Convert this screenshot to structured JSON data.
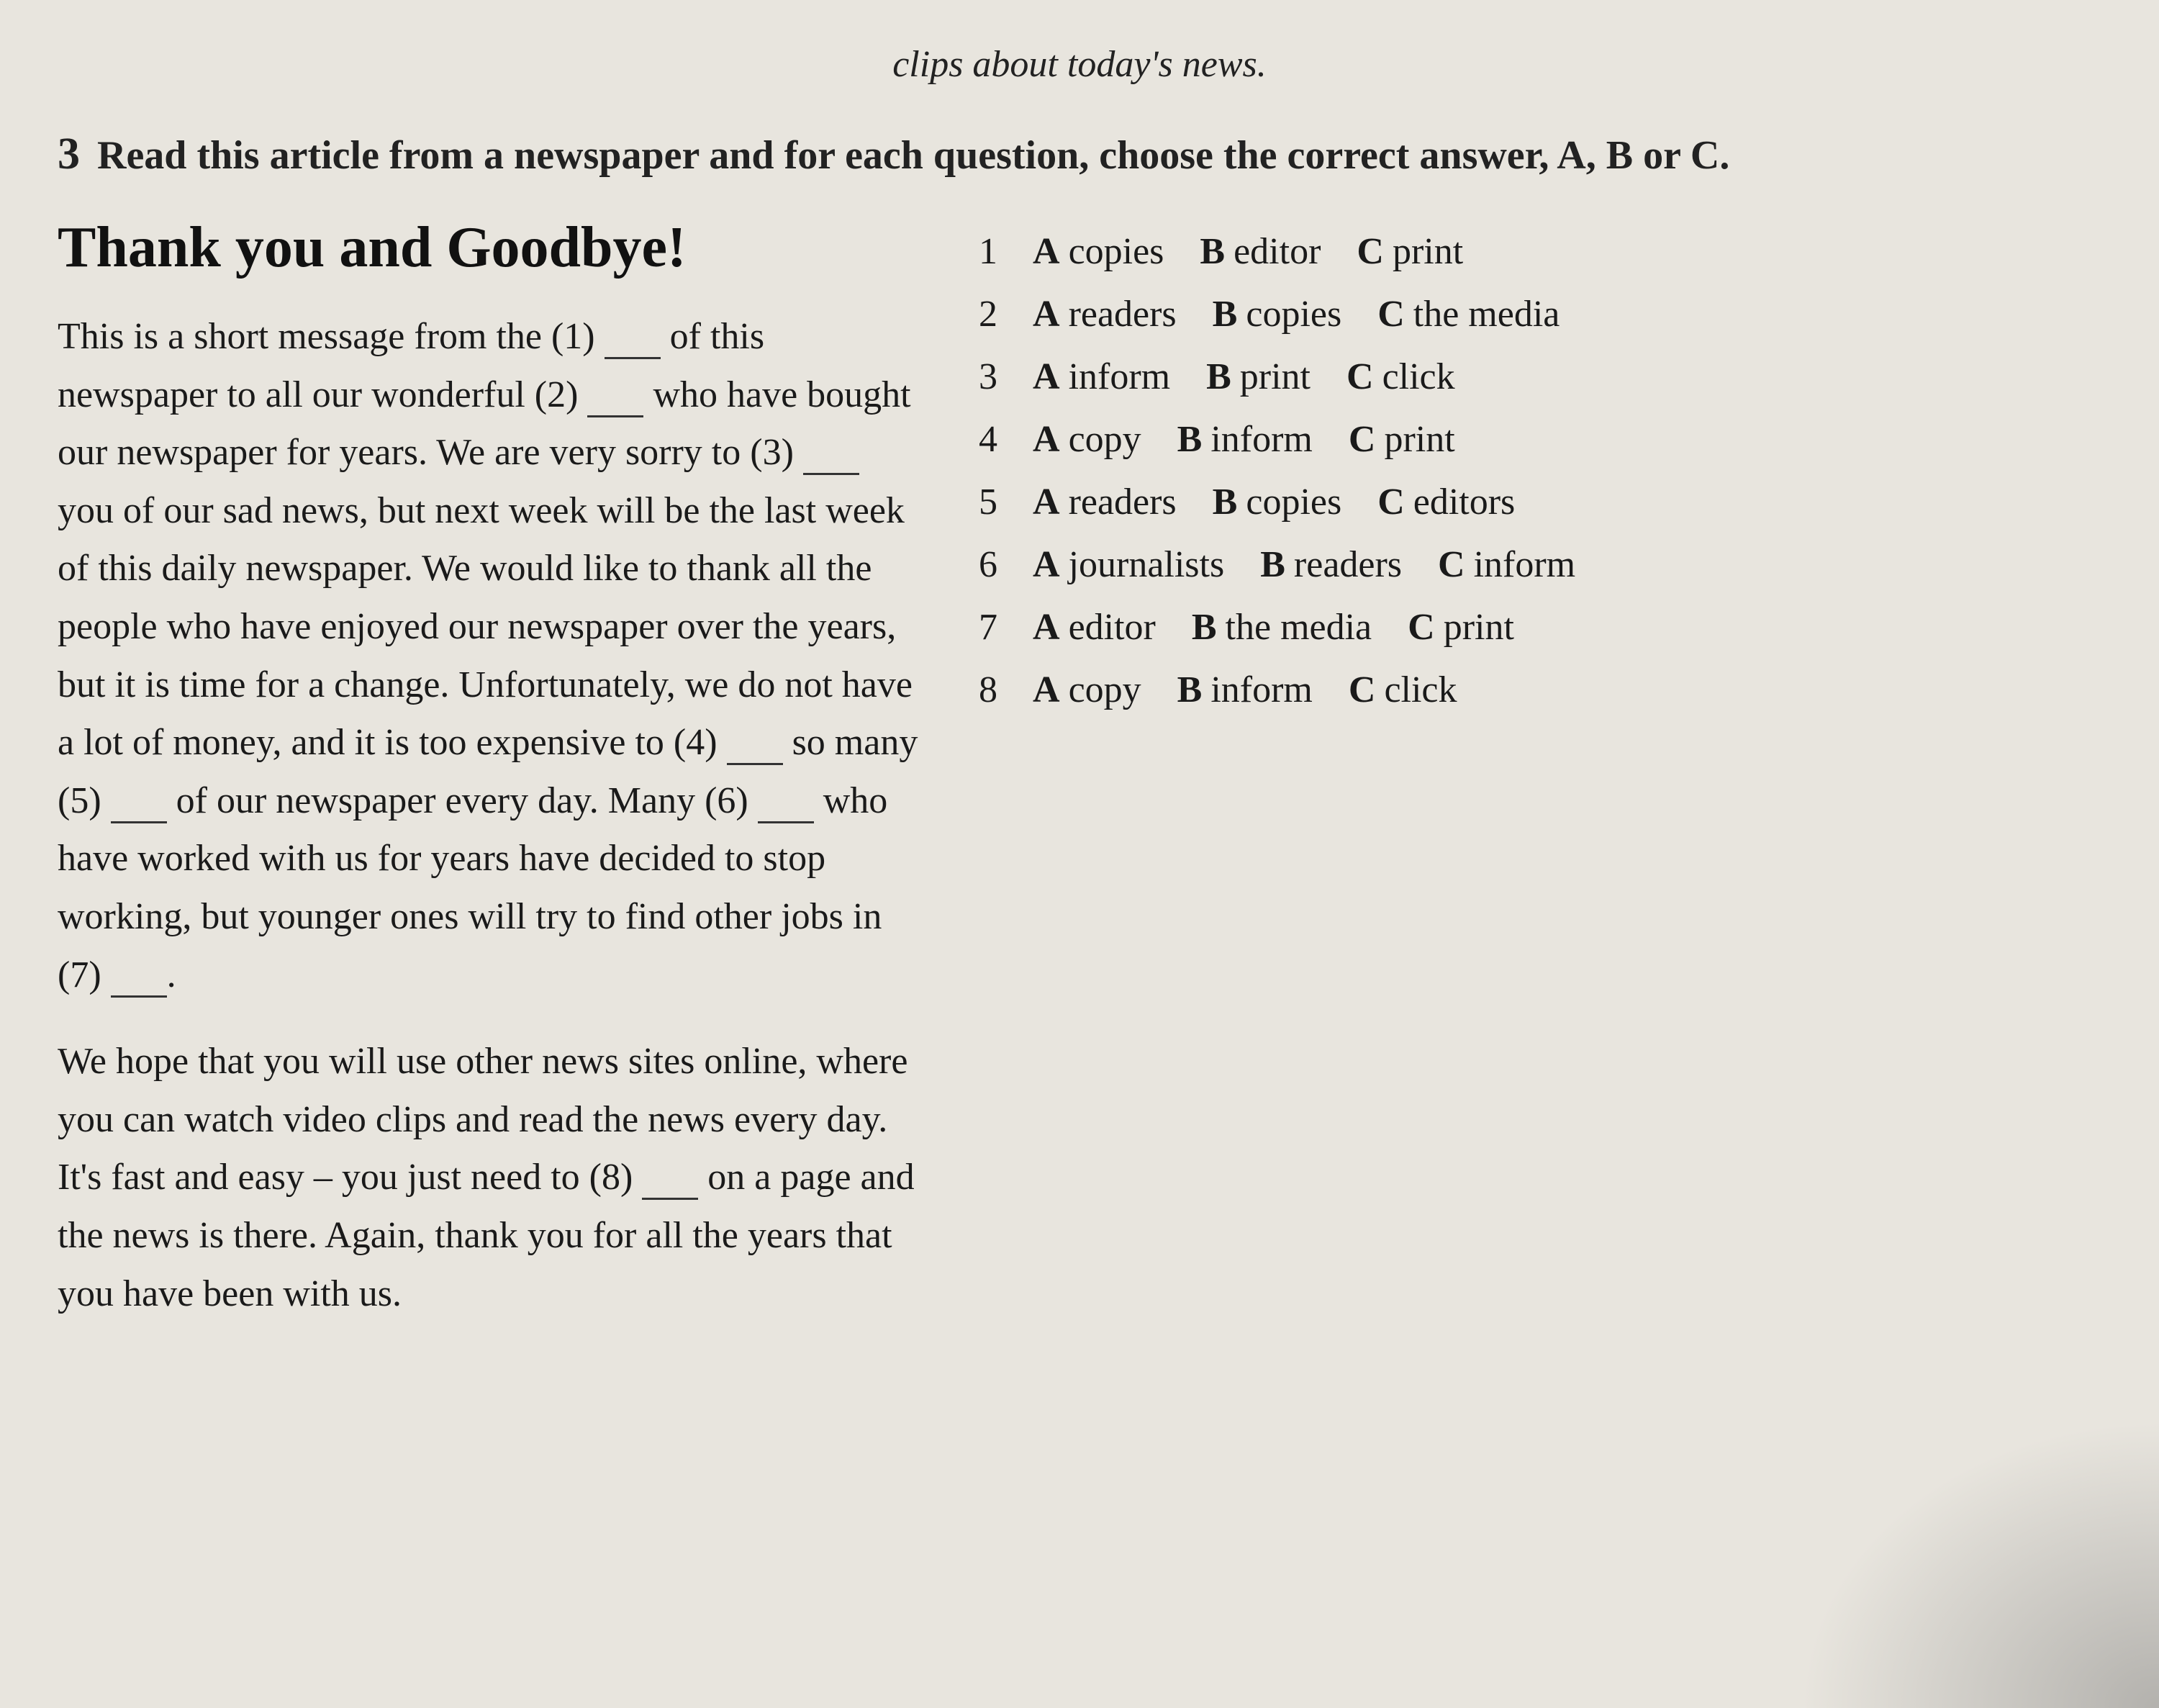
{
  "page": {
    "top_text": "clips about today's news.",
    "section_number": "3",
    "section_instruction": "Read this article from a newspaper and for each question, choose the correct answer, A, B or C.",
    "article": {
      "title": "Thank you and Goodbye!",
      "paragraph1": "This is a short message from the (1) ___ of this newspaper to all our wonderful (2) ___ who have bought our newspaper for years. We are very sorry to (3) ___ you of our sad news, but next week will be the last week of this daily newspaper. We would like to thank all the people who have enjoyed our newspaper over the years, but it is time for a change. Unfortunately, we do not have a lot of money, and it is too expensive to (4) ___ so many (5) ___ of our newspaper every day. Many (6) ___ who have worked with us for years have decided to stop working, but younger ones will try to find other jobs in (7) ___.",
      "paragraph2": "We hope that you will use other news sites online, where you can watch video clips and read the news every day. It's fast and easy – you just need to (8) ___ on a page and the news is there. Again, thank you for all the years that you have been with us."
    },
    "questions": [
      {
        "number": "1",
        "options": [
          {
            "letter": "A",
            "text": "copies"
          },
          {
            "letter": "B",
            "text": "editor"
          },
          {
            "letter": "C",
            "text": "print"
          }
        ]
      },
      {
        "number": "2",
        "options": [
          {
            "letter": "A",
            "text": "readers"
          },
          {
            "letter": "B",
            "text": "copies"
          },
          {
            "letter": "C",
            "text": "the media"
          }
        ]
      },
      {
        "number": "3",
        "options": [
          {
            "letter": "A",
            "text": "inform"
          },
          {
            "letter": "B",
            "text": "print"
          },
          {
            "letter": "C",
            "text": "click"
          }
        ]
      },
      {
        "number": "4",
        "options": [
          {
            "letter": "A",
            "text": "copy"
          },
          {
            "letter": "B",
            "text": "inform"
          },
          {
            "letter": "C",
            "text": "print"
          }
        ]
      },
      {
        "number": "5",
        "options": [
          {
            "letter": "A",
            "text": "readers"
          },
          {
            "letter": "B",
            "text": "copies"
          },
          {
            "letter": "C",
            "text": "editors"
          }
        ]
      },
      {
        "number": "6",
        "options": [
          {
            "letter": "A",
            "text": "journalists"
          },
          {
            "letter": "B",
            "text": "readers"
          },
          {
            "letter": "C",
            "text": "inform"
          }
        ]
      },
      {
        "number": "7",
        "options": [
          {
            "letter": "A",
            "text": "editor"
          },
          {
            "letter": "B",
            "text": "the media"
          },
          {
            "letter": "C",
            "text": "print"
          }
        ]
      },
      {
        "number": "8",
        "options": [
          {
            "letter": "A",
            "text": "copy"
          },
          {
            "letter": "B",
            "text": "inform"
          },
          {
            "letter": "C",
            "text": "click"
          }
        ]
      }
    ]
  }
}
